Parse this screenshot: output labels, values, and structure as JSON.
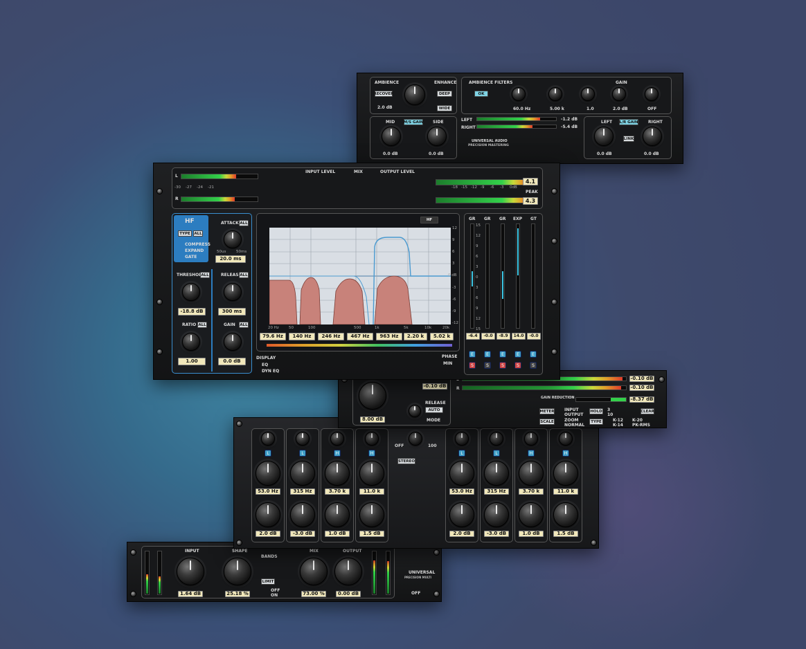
{
  "ambience_panel": {
    "ambience_label": "AMBIENCE",
    "enhance_label": "ENHANCE",
    "recover_label": "RECOVER",
    "ambience_value": "2.0 dB",
    "deep_label": "DEEP",
    "wide_label": "WIDE",
    "filters_label": "AMBIENCE FILTERS",
    "ok_label": "OK",
    "gain_label": "GAIN",
    "filter_values": [
      "60.0 Hz",
      "5.00 k",
      "1.0",
      "2.0 dB",
      "OFF"
    ],
    "mid_label": "MID",
    "side_label": "SIDE",
    "ms_gain_label": "M/S GAIN",
    "mid_value": "0.0 dB",
    "side_value": "0.0 dB",
    "left_label": "LEFT",
    "right_label": "RIGHT",
    "lr_gain_label": "L/R GAIN",
    "link_label": "LINK",
    "left_value": "0.0 dB",
    "right_value": "0.0 dB",
    "meter_left": "LEFT",
    "meter_right": "RIGHT",
    "peak_left": "-1.2 dB",
    "peak_right": "-5.4 dB",
    "brand": "UNIVERSAL AUDIO",
    "brand_sub": "PRECISION MASTERING"
  },
  "main_panel": {
    "meter_l": "L",
    "meter_r": "R",
    "meter_ticks": [
      "-30",
      "-27",
      "-24",
      "-21",
      "-18",
      "-15",
      "-12",
      "-9",
      "-6",
      "-3",
      "0dB"
    ],
    "peak_top": "4.1",
    "peak_bottom": "4.3",
    "peak_label": "PEAK",
    "input_level_label": "INPUT LEVEL",
    "mix_label": "MIX",
    "output_level_label": "OUTPUT LEVEL",
    "band_title": "HF",
    "type_label": "TYPE",
    "all_label": "ALL",
    "mode_options": [
      "COMPRESS",
      "EXPAND",
      "GATE"
    ],
    "attack_label": "ATTACK",
    "attack_range": [
      "50us",
      "50ms"
    ],
    "attack_value": "20.0 ms",
    "threshold_label": "THRESHOLD",
    "threshold_value": "-18.8 dB",
    "release_label": "RELEASE",
    "release_value": "300 ms",
    "ratio_label": "RATIO",
    "ratio_value": "1.00",
    "gain_label": "GAIN",
    "gain_value": "0.0 dB",
    "graph_tab": "HF",
    "freq_ticks": [
      "20 Hz",
      "50",
      "100",
      "500",
      "1k",
      "5k",
      "10k",
      "20k"
    ],
    "db_ticks": [
      "12",
      "9",
      "6",
      "3",
      "0 dB",
      "-3",
      "-6",
      "-9",
      "-12"
    ],
    "freq_values": [
      "79.6 Hz",
      "140 Hz",
      "246 Hz",
      "467 Hz",
      "963 Hz",
      "2.20 k",
      "5.02 k"
    ],
    "display_label": "DISPLAY",
    "display_options": [
      "EQ",
      "DYN EQ"
    ],
    "phase_label": "PHASE",
    "phase_value": "MIN",
    "gr_headers": [
      "GR",
      "GR",
      "GR",
      "EXP",
      "GT"
    ],
    "gr_scale": [
      "15",
      "12",
      "9",
      "6",
      "3",
      "0",
      "3",
      "6",
      "9",
      "12",
      "15"
    ],
    "gr_values": [
      "-6.4",
      "-0.0",
      "-8.9",
      "14.0",
      "-0.0"
    ],
    "gr_buttons": [
      "E",
      "E",
      "E",
      "E",
      "E"
    ],
    "solo_buttons": [
      "S",
      "S",
      "S",
      "S",
      "S"
    ]
  },
  "limiter_panel": {
    "release_label": "RELEASE",
    "auto_label": "AUTO",
    "mode_label": "MODE",
    "ceiling_value": "-0.10 dB",
    "knob_value": "8.00 dB",
    "meter_l": "L",
    "meter_r": "R",
    "peak_values": [
      "-0.10 dB",
      "-0.10 dB"
    ],
    "gr_label": "GAIN REDUCTION",
    "gr_value": "-8.37 dB",
    "meter_label": "METER",
    "meter_options": [
      "INPUT",
      "OUTPUT"
    ],
    "hold_label": "HOLD",
    "hold_values": [
      "3",
      "10"
    ],
    "clear_label": "CLEAR",
    "scale_label": "SCALE",
    "scale_options": [
      "ZOOM",
      "NORMAL"
    ],
    "type_label": "TYPE",
    "type_options": [
      "K-12",
      "K-14",
      "K-20",
      "PK-RMS"
    ]
  },
  "eq_panel": {
    "band_labels": [
      "L",
      "L",
      "H",
      "H"
    ],
    "freq_values": [
      "53.0 Hz",
      "315 Hz",
      "3.70 k",
      "11.0 k"
    ],
    "gain_values": [
      "2.0 dB",
      "-3.0 dB",
      "1.0 dB",
      "1.5 dB"
    ],
    "stereo_label": "STEREO",
    "off_label": "OFF",
    "range_max": "100"
  },
  "mbc_panel": {
    "input_label": "INPUT",
    "input_value": "1.64 dB",
    "shape_label": "SHAPE",
    "shape_value": "25.18 %",
    "bands_label": "BANDS",
    "limit_label": "LIMIT",
    "limit_options": [
      "OFF",
      "ON"
    ],
    "mix_label": "MIX",
    "mix_value": "73.00 %",
    "output_label": "OUTPUT",
    "output_value": "0.00 dB",
    "brand": "UNIVERSAL",
    "brand_sub": "PRECISION MULTI",
    "off_label": "OFF"
  }
}
